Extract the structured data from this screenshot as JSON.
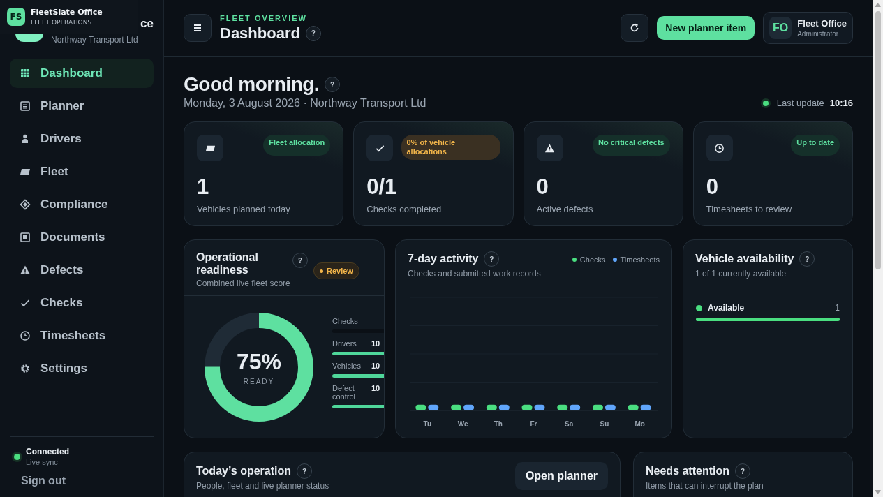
{
  "tooltip": {
    "badge": "FS",
    "title": "FleetSlate Office",
    "subtitle": "FLEET OPERATIONS"
  },
  "brand": {
    "title": "ce",
    "subtitle": "Northway Transport Ltd"
  },
  "sidebar": {
    "items": [
      {
        "label": "Dashboard",
        "selected": true
      },
      {
        "label": "Planner",
        "selected": false
      },
      {
        "label": "Drivers",
        "selected": false
      },
      {
        "label": "Fleet",
        "selected": false
      },
      {
        "label": "Compliance",
        "selected": false
      },
      {
        "label": "Documents",
        "selected": false
      },
      {
        "label": "Defects",
        "selected": false
      },
      {
        "label": "Checks",
        "selected": false
      },
      {
        "label": "Timesheets",
        "selected": false
      },
      {
        "label": "Settings",
        "selected": false
      }
    ],
    "status": {
      "label": "Connected",
      "detail": "Live sync",
      "color": "#4ade80"
    },
    "sign_out": "Sign out"
  },
  "header": {
    "eyebrow": "FLEET OVERVIEW",
    "title": "Dashboard",
    "help": "?",
    "button": "New planner item",
    "user": {
      "initials": "FO",
      "name": "Fleet Office",
      "role": "Administrator"
    }
  },
  "greeting": {
    "title": "Good morning.",
    "help": "?",
    "subtitle": "Monday, 3 August 2026 · Northway Transport Ltd",
    "last_update": {
      "label": "Last update",
      "time": "10:16"
    }
  },
  "stats": [
    {
      "kind": "ok",
      "badge": "Fleet allocation",
      "value": "1",
      "label": "Vehicles planned today"
    },
    {
      "kind": "warn",
      "badge": "0% of vehicle allocations",
      "value": "0/1",
      "label": "Checks completed"
    },
    {
      "kind": "ok",
      "badge": "No critical defects",
      "value": "0",
      "label": "Active defects"
    },
    {
      "kind": "ok",
      "badge": "Up to date",
      "value": "0",
      "label": "Timesheets to review"
    }
  ],
  "readiness": {
    "title": "Operational readiness",
    "help": "?",
    "subtitle": "Combined live fleet score",
    "status": "Review",
    "level": 0.75,
    "percent": "75%",
    "caption": "READY",
    "rows": [
      {
        "label": "Checks",
        "level": 0
      },
      {
        "label": "Drivers",
        "value": "10",
        "level": 1
      },
      {
        "label": "Vehicles",
        "value": "10",
        "level": 1
      },
      {
        "label": "Defect control",
        "value": "10",
        "level": 1
      }
    ]
  },
  "activity": {
    "title": "7-day activity",
    "help": "?",
    "subtitle": "Checks and submitted work records",
    "legend": [
      {
        "label": "Checks",
        "color": "#4ade80"
      },
      {
        "label": "Timesheets",
        "color": "#60a5fa"
      }
    ],
    "days": [
      "Tu",
      "We",
      "Th",
      "Fr",
      "Sa",
      "Su",
      "Mo"
    ]
  },
  "availability": {
    "title": "Vehicle availability",
    "help": "?",
    "subtitle": "1 of 1 currently available",
    "rows": [
      {
        "label": "Available",
        "count": "1",
        "level": 1,
        "color": "#4ade80"
      }
    ]
  },
  "operation": {
    "title": "Today’s operation",
    "help": "?",
    "subtitle": "People, fleet and live planner status",
    "button": "Open planner"
  },
  "attention": {
    "title": "Needs attention",
    "help": "?",
    "subtitle": "Items that can interrupt the plan"
  }
}
